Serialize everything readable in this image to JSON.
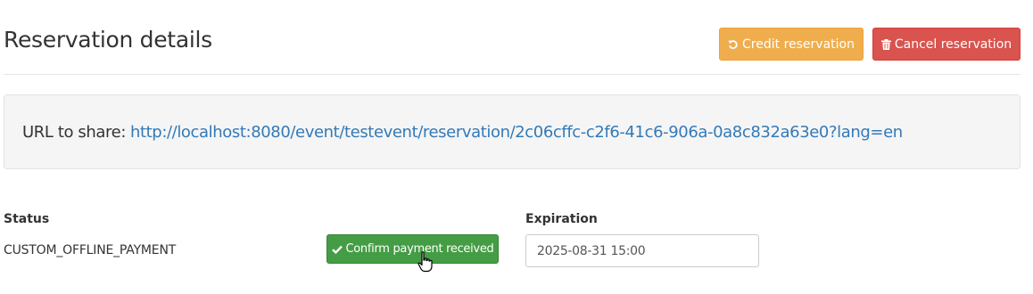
{
  "header": {
    "title": "Reservation details",
    "credit_label": "Credit reservation",
    "cancel_label": "Cancel reservation",
    "credit_icon": "undo-icon",
    "cancel_icon": "trash-icon"
  },
  "share": {
    "label": "URL to share:",
    "url": "http://localhost:8080/event/testevent/reservation/2c06cffc-c2f6-41c6-906a-0a8c832a63e0?lang=en"
  },
  "status": {
    "label": "Status",
    "value": "CUSTOM_OFFLINE_PAYMENT",
    "confirm_label": "Confirm payment received",
    "confirm_icon": "check-icon"
  },
  "expiration": {
    "label": "Expiration",
    "value": "2025-08-31 15:00"
  },
  "colors": {
    "credit": "#f0ad4e",
    "cancel": "#d9534f",
    "confirm": "#449d44",
    "link": "#337ab7"
  }
}
